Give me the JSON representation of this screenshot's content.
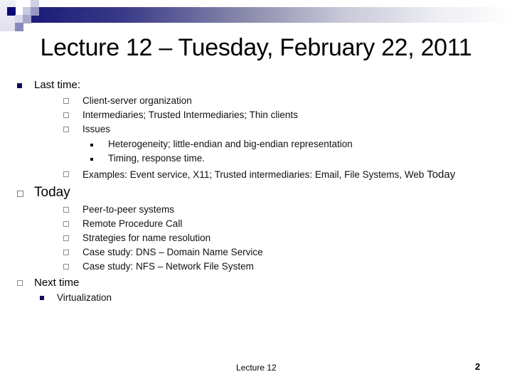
{
  "slide": {
    "title": "Lecture 12 – Tuesday, February 22, 2011",
    "last_time": {
      "label": "Last time:",
      "items": [
        "Client-server organization",
        "Intermediaries; Trusted Intermediaries; Thin clients",
        "Issues"
      ],
      "issues_subitems": [
        "Heterogeneity; little-endian and big-endian representation",
        "Timing, response time."
      ],
      "examples": "Examples: Event service, X11; Trusted intermediaries: Email, File Systems, Web",
      "examples_tail": "Today"
    },
    "today": {
      "label": "Today",
      "items": [
        "Peer-to-peer systems",
        "Remote Procedure Call",
        "Strategies for name resolution",
        "Case study: DNS – Domain Name Service",
        "Case study: NFS – Network File System"
      ]
    },
    "next_time": {
      "label": "Next time",
      "items": [
        "Virtualization"
      ]
    },
    "footer": "Lecture 12",
    "page_number": "2"
  },
  "colors": {
    "navy": "#0d0d5c",
    "banner_start": "#1a1a78",
    "bullet_gray": "#7a7a99"
  }
}
